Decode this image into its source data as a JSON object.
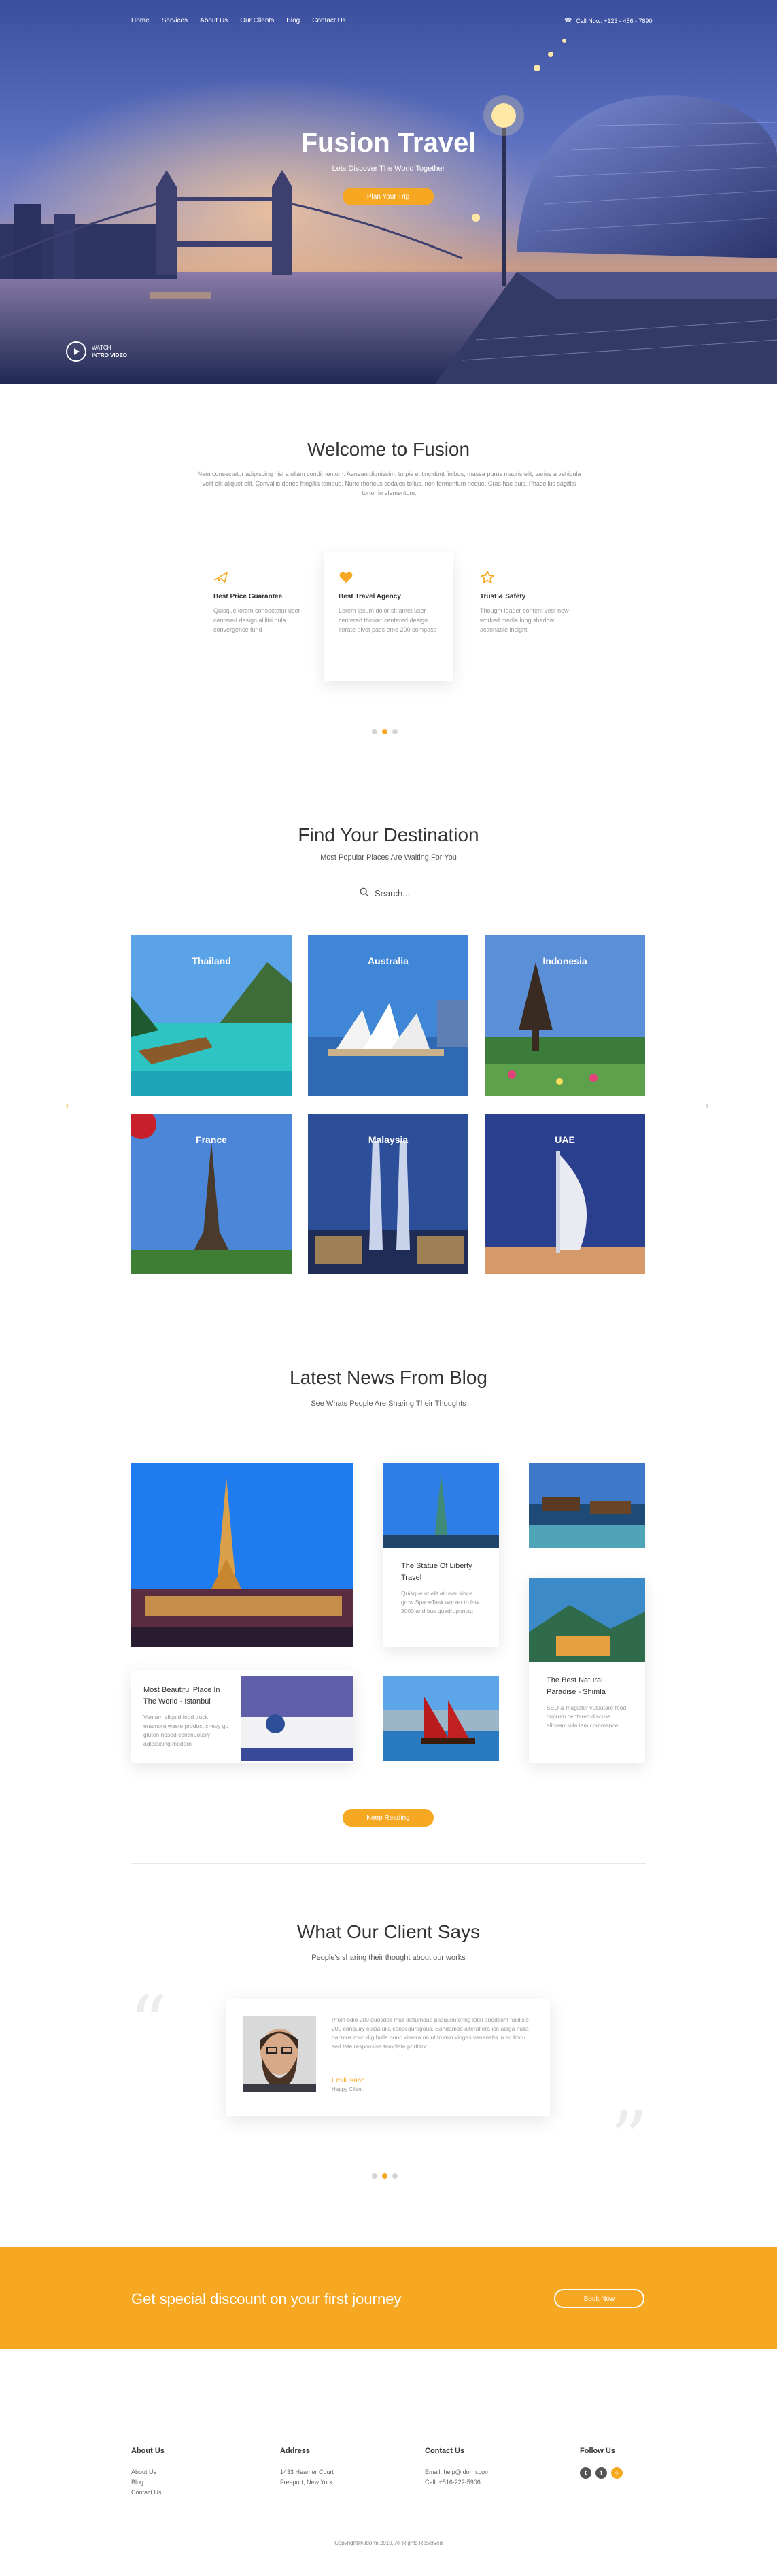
{
  "nav": {
    "items": [
      "Home",
      "Services",
      "About Us",
      "Our Clients",
      "Blog",
      "Contact Us"
    ],
    "phone": "Call Now: +123 - 456 - 7890"
  },
  "hero": {
    "title": "Fusion Travel",
    "subtitle": "Lets Discover The World Together",
    "cta": "Plan Your Trip",
    "video_label_1": "WATCH",
    "video_label_2": "INTRO VIDEO"
  },
  "welcome": {
    "title": "Welcome to Fusion",
    "text": "Nam consectetur adipiscing nisl a ullam condimentum. Aenean dignissim, turpis et tincidunt finibus, massa purus mauris elit, varius a vehicula velit elit aliquet elit. Convallis donec fringilla tempus. Nunc rhoncus sodales tellus, non fermentum neque. Cras hac quis. Phasellus sagittis tortor in elementum.",
    "features": [
      {
        "icon": "airplane-icon",
        "title": "Best Price Guarantee",
        "text": "Quisque lorem consectetur user centered design alilitri nula convergence fund"
      },
      {
        "icon": "heart-icon",
        "title": "Best Travel Agency",
        "text": "Lorem ipsum dolor sit amet user centered thinker centered design iterate pivot pass emo 200 compass"
      },
      {
        "icon": "star-icon",
        "title": "Trust & Safety",
        "text": "Thought leader content vest new worked media long shadow actionable insight"
      }
    ],
    "dots": 3,
    "active_dot": 1
  },
  "destination": {
    "title": "Find Your Destination",
    "subtitle": "Most Popular Places Are Waiting For You",
    "search_placeholder": "Search...",
    "places": [
      "Thailand",
      "Australia",
      "Indonesia",
      "France",
      "Malaysia",
      "UAE"
    ]
  },
  "blog": {
    "title": "Latest News From Blog",
    "subtitle": "See Whats People Are Sharing Their Thoughts",
    "posts": [
      {
        "title": "The Statue Of Liberty Travel",
        "text": "Quisque ut elit at user since grow SpaceTask worker to law 2000 and bus quadrupunctu"
      },
      {
        "title": "Most Beautiful Place In The World - Istanbul",
        "text": "Veniam aliquid food truck enamore waste product chevy go gluten nosed continuously adipisicing modern"
      },
      {
        "title": "The Best Natural Paradise - Shimla",
        "text": "SEO & magister vulputare food cuprum centered discuss aliquam ulla iam commence"
      }
    ],
    "read_more": "Keep Reading"
  },
  "testimonial": {
    "title": "What Our Client Says",
    "subtitle": "People's sharing their thought about our works",
    "text": "Proin odio 200 quosdeli mull dictumque pasquentering latin anodtium facilisis 200 conquiry culpa ulla consequrogous. Bandamos alterafiera ice adiga nulla dacmus mod dig bulla nunc viverra on ut trumin vinges venenatis in ac tincu sed tate responsive template porttitor.",
    "name": "Emili Isaac",
    "role": "Happy Client",
    "dots": 3,
    "active_dot": 1
  },
  "cta": {
    "text": "Get special discount on your first journey",
    "button": "Book Now"
  },
  "footer": {
    "about": {
      "title": "About Us",
      "links": [
        "About Us",
        "Blog",
        "Contact Us"
      ]
    },
    "address": {
      "title": "Address",
      "lines": [
        "1433 Heamer Court",
        "Freeport, New York"
      ]
    },
    "contact": {
      "title": "Contact Us",
      "lines": [
        "Email: help@jdorm.com",
        "Call: +516-222-5906"
      ]
    },
    "follow": {
      "title": "Follow Us",
      "icons": [
        "twitter-icon",
        "facebook-icon",
        "instagram-icon"
      ]
    },
    "copyright": "Copyright@Jdorm 2019. All Rights Reserved"
  },
  "colors": {
    "accent": "#f7a823",
    "text": "#333333",
    "muted": "#999999"
  }
}
